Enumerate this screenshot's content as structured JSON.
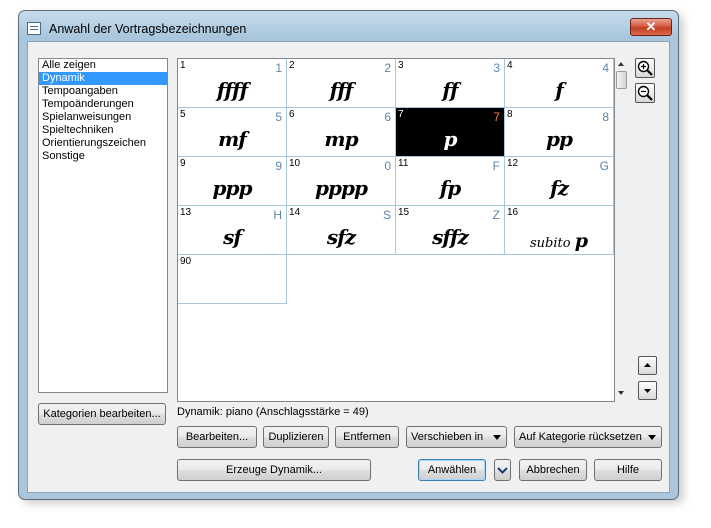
{
  "window": {
    "title": "Anwahl der Vortragsbezeichnungen",
    "close_label": "✕"
  },
  "categories": {
    "items": [
      {
        "label": "Alle zeigen",
        "selected": false
      },
      {
        "label": "Dynamik",
        "selected": true
      },
      {
        "label": "Tempoangaben",
        "selected": false
      },
      {
        "label": "Tempoänderungen",
        "selected": false
      },
      {
        "label": "Spielanweisungen",
        "selected": false
      },
      {
        "label": "Spieltechniken",
        "selected": false
      },
      {
        "label": "Orientierungszeichen",
        "selected": false
      },
      {
        "label": "Sonstige",
        "selected": false
      }
    ],
    "edit_button": "Kategorien bearbeiten..."
  },
  "palette": {
    "cells": [
      {
        "num": "1",
        "key": "1",
        "glyph": "ffff"
      },
      {
        "num": "2",
        "key": "2",
        "glyph": "fff"
      },
      {
        "num": "3",
        "key": "3",
        "glyph": "ff"
      },
      {
        "num": "4",
        "key": "4",
        "glyph": "f"
      },
      {
        "num": "5",
        "key": "5",
        "glyph": "mf"
      },
      {
        "num": "6",
        "key": "6",
        "glyph": "mp"
      },
      {
        "num": "7",
        "key": "7",
        "glyph": "p",
        "selected": true
      },
      {
        "num": "8",
        "key": "8",
        "glyph": "pp"
      },
      {
        "num": "9",
        "key": "9",
        "glyph": "ppp"
      },
      {
        "num": "10",
        "key": "0",
        "glyph": "pppp"
      },
      {
        "num": "11",
        "key": "F",
        "glyph": "fp"
      },
      {
        "num": "12",
        "key": "G",
        "glyph": "fz"
      },
      {
        "num": "13",
        "key": "H",
        "glyph": "sf"
      },
      {
        "num": "14",
        "key": "S",
        "glyph": "sfz"
      },
      {
        "num": "15",
        "key": "Z",
        "glyph": "sffz"
      },
      {
        "num": "16",
        "key": "",
        "glyph": "p",
        "prefix": "subito"
      },
      {
        "num": "90",
        "key": "",
        "glyph": ""
      }
    ]
  },
  "status": {
    "text": "Dynamik: piano (Anschlagsstärke = 49)"
  },
  "toolbar": {
    "edit": "Bearbeiten...",
    "duplicate": "Duplizieren",
    "remove": "Entfernen",
    "move": "Verschieben in",
    "reset": "Auf Kategorie rücksetzen"
  },
  "footer": {
    "create": "Erzeuge Dynamik...",
    "select": "Anwählen",
    "cancel": "Abbrechen",
    "help": "Hilfe"
  }
}
